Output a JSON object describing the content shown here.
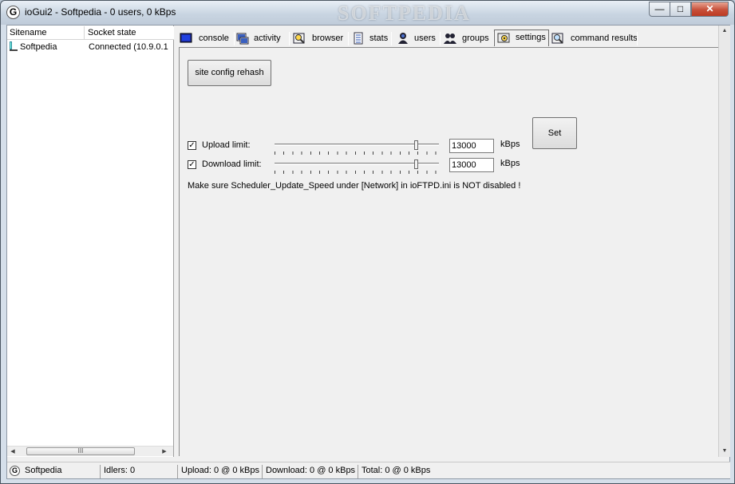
{
  "window": {
    "title": "ioGui2 - Softpedia - 0 users, 0 kBps",
    "watermark": "SOFTPEDIA",
    "app_icon_letter": "G",
    "controls": {
      "minimize": "—",
      "maximize": "□",
      "close": "✕"
    }
  },
  "site_list": {
    "columns": [
      "Sitename",
      "Socket state"
    ],
    "rows": [
      {
        "name": "Softpedia",
        "state": "Connected (10.9.0.1"
      }
    ],
    "scrollbar_grip": "III"
  },
  "tabs": [
    {
      "label": "console",
      "icon": "console-icon"
    },
    {
      "label": "activity",
      "icon": "activity-icon"
    },
    {
      "label": "browser",
      "icon": "browser-icon"
    },
    {
      "label": "stats",
      "icon": "stats-icon"
    },
    {
      "label": "users",
      "icon": "users-icon"
    },
    {
      "label": "groups",
      "icon": "groups-icon"
    },
    {
      "label": "settings",
      "icon": "settings-icon",
      "active": true
    },
    {
      "label": "command results",
      "icon": "command-results-icon"
    }
  ],
  "settings": {
    "rehash_label": "site config rehash",
    "upload": {
      "label": "Upload limit:",
      "checked": true,
      "value": "13000",
      "unit": "kBps",
      "slider_fraction": 0.87
    },
    "download": {
      "label": "Download limit:",
      "checked": true,
      "value": "13000",
      "unit": "kBps",
      "slider_fraction": 0.87
    },
    "set_label": "Set",
    "note": "Make sure Scheduler_Update_Speed under [Network] in ioFTPD.ini is NOT disabled !"
  },
  "statusbar": {
    "site": "Softpedia",
    "idlers": "Idlers: 0",
    "upload": "Upload: 0 @ 0 kBps",
    "download": "Download: 0 @ 0 kBps",
    "total": "Total: 0 @ 0 kBps"
  }
}
